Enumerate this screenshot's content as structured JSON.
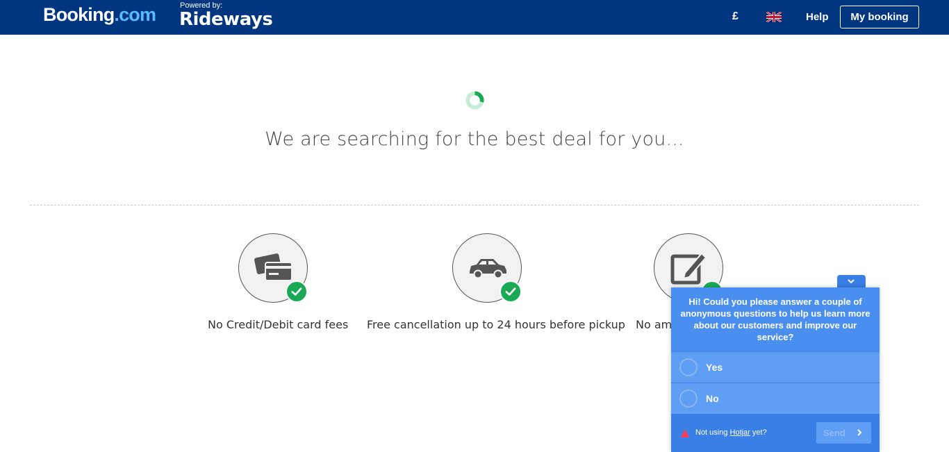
{
  "header": {
    "logo_booking": "Booking",
    "logo_booking_suffix": ".com",
    "powered_by": "Powered by:",
    "logo_rideways": "Rideways",
    "currency": "£",
    "language_icon": "uk-flag-icon",
    "help": "Help",
    "my_booking": "My booking"
  },
  "main": {
    "loading_icon": "spinner-icon",
    "searching_text": "We are searching for the best deal for you...",
    "features": [
      {
        "icon": "credit-card-icon",
        "label": "No Credit/Debit card fees"
      },
      {
        "icon": "car-icon",
        "label": "Free cancellation up to 24 hours before pickup"
      },
      {
        "icon": "edit-icon",
        "label": "No amendment fees"
      }
    ]
  },
  "hotjar": {
    "question": "Hi! Could you please answer a couple of anonymous questions to help us learn more about our customers and improve our service?",
    "options": [
      "Yes",
      "No"
    ],
    "footer_prefix": "Not using ",
    "footer_link": "Hotjar",
    "footer_suffix": " yet?",
    "send": "Send"
  },
  "colors": {
    "header_bg": "#003580",
    "accent_blue": "#5bbaff",
    "check_green": "#1aaa55",
    "widget_blue": "#4a8ff0"
  }
}
